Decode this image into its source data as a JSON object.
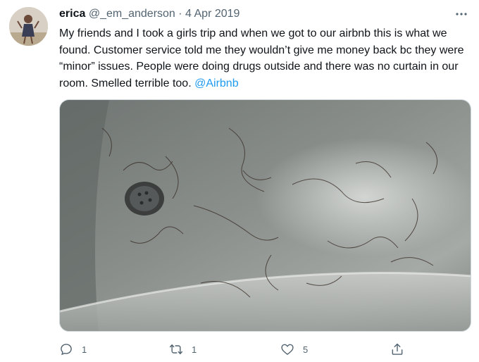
{
  "tweet": {
    "display_name": "erica",
    "handle": "@_em_anderson",
    "separator": "·",
    "date": "4 Apr 2019",
    "text": "My friends and I took a girls trip and when we got to our airbnb this is what we found. Customer service told me they wouldn’t give me money back bc they were “minor” issues. People were doing drugs outside and there was no curtain in our room. Smelled terrible too.",
    "mention": "@Airbnb"
  },
  "actions": {
    "reply_count": "1",
    "retweet_count": "1",
    "like_count": "5"
  },
  "icons": {
    "avatar": "profile-photo",
    "more": "more-dots-icon",
    "reply": "reply-bubble-icon",
    "retweet": "retweet-arrows-icon",
    "like": "heart-icon",
    "share": "share-upload-icon"
  },
  "colors": {
    "text": "#0f1419",
    "secondary": "#536471",
    "link": "#1d9bf0"
  }
}
